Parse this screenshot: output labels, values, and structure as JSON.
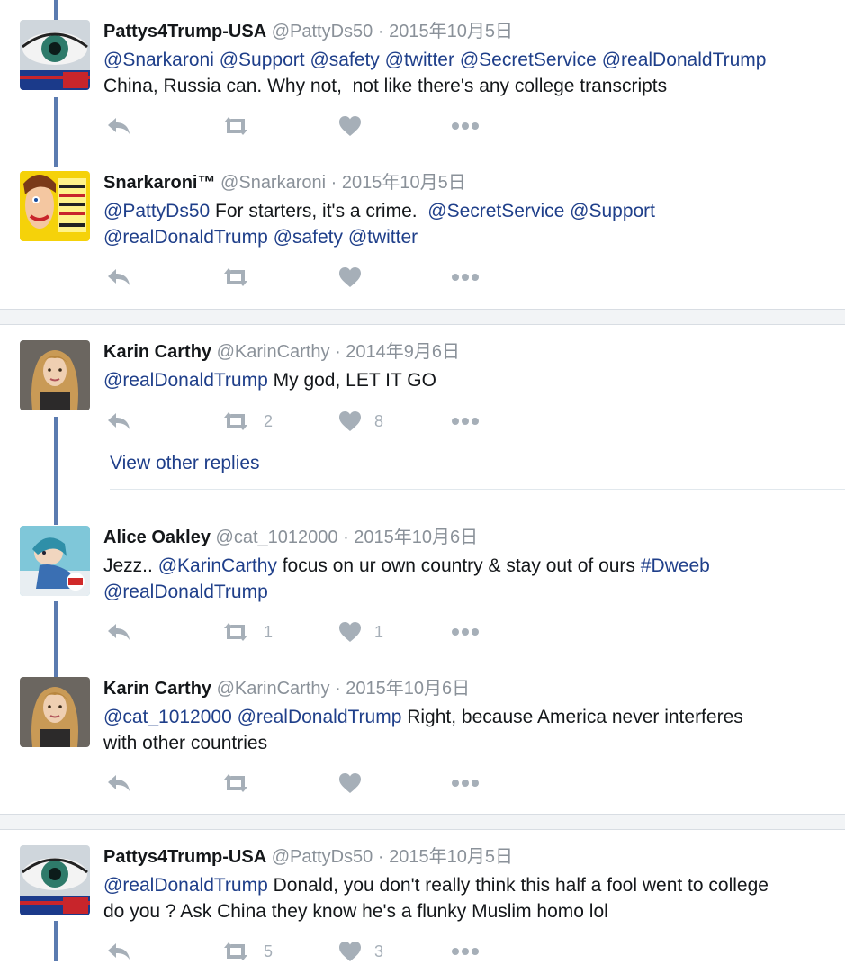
{
  "colors": {
    "link": "#1f3f8a",
    "muted": "#8a9199",
    "thread_line": "#5b7bb0",
    "action_icon": "#a6afb8"
  },
  "tweets": [
    {
      "name": "Pattys4Trump-USA",
      "handle": "@PattyDs50",
      "separator": "·",
      "date": "2015年10月5日",
      "avatar": "eye-flag-avatar",
      "line1": [
        {
          "t": "@Snarkaroni",
          "m": true
        },
        {
          "t": " ",
          "m": false
        },
        {
          "t": "@Support",
          "m": true
        },
        {
          "t": " ",
          "m": false
        },
        {
          "t": "@safety",
          "m": true
        },
        {
          "t": " ",
          "m": false
        },
        {
          "t": "@twitter",
          "m": true
        },
        {
          "t": " ",
          "m": false
        },
        {
          "t": "@SecretService",
          "m": true
        },
        {
          "t": " ",
          "m": false
        },
        {
          "t": "@realDonaldTrump",
          "m": true
        }
      ],
      "line2": [
        {
          "t": "China, Russia can. Why not,  not like there's any college transcripts",
          "m": false
        }
      ],
      "retweets": "",
      "likes": ""
    },
    {
      "name": "Snarkaroni™",
      "handle": "@Snarkaroni",
      "separator": "·",
      "date": "2015年10月5日",
      "avatar": "comic-book-avatar",
      "line1": [
        {
          "t": "@PattyDs50",
          "m": true
        },
        {
          "t": " For starters, it's a crime.  ",
          "m": false
        },
        {
          "t": "@SecretService",
          "m": true
        },
        {
          "t": " ",
          "m": false
        },
        {
          "t": "@Support",
          "m": true
        }
      ],
      "line2": [
        {
          "t": "@realDonaldTrump",
          "m": true
        },
        {
          "t": " ",
          "m": false
        },
        {
          "t": "@safety",
          "m": true
        },
        {
          "t": " ",
          "m": false
        },
        {
          "t": "@twitter",
          "m": true
        }
      ],
      "retweets": "",
      "likes": ""
    },
    {
      "name": "Karin Carthy",
      "handle": "@KarinCarthy",
      "separator": "·",
      "date": "2014年9月6日",
      "avatar": "woman-portrait-avatar",
      "line1": [
        {
          "t": "@realDonaldTrump",
          "m": true
        },
        {
          "t": " My god, LET IT GO",
          "m": false
        }
      ],
      "line2": [],
      "retweets": "2",
      "likes": "8"
    },
    {
      "name": "Alice Oakley",
      "handle": "@cat_1012000",
      "separator": "·",
      "date": "2015年10月6日",
      "avatar": "illustration-avatar",
      "line1": [
        {
          "t": "Jezz.. ",
          "m": false
        },
        {
          "t": "@KarinCarthy",
          "m": true
        },
        {
          "t": " focus on ur own country & stay out of ours ",
          "m": false
        },
        {
          "t": "#Dweeb",
          "m": true
        }
      ],
      "line2": [
        {
          "t": "@realDonaldTrump",
          "m": true
        }
      ],
      "retweets": "1",
      "likes": "1"
    },
    {
      "name": "Karin Carthy",
      "handle": "@KarinCarthy",
      "separator": "·",
      "date": "2015年10月6日",
      "avatar": "woman-portrait-avatar",
      "line1": [
        {
          "t": "@cat_1012000",
          "m": true
        },
        {
          "t": " ",
          "m": false
        },
        {
          "t": "@realDonaldTrump",
          "m": true
        },
        {
          "t": " Right, because America never interferes",
          "m": false
        }
      ],
      "line2": [
        {
          "t": "with other countries",
          "m": false
        }
      ],
      "retweets": "",
      "likes": ""
    },
    {
      "name": "Pattys4Trump-USA",
      "handle": "@PattyDs50",
      "separator": "·",
      "date": "2015年10月5日",
      "avatar": "eye-flag-avatar",
      "line1": [
        {
          "t": "@realDonaldTrump",
          "m": true
        },
        {
          "t": " Donald, you don't really think this half a fool went to college",
          "m": false
        }
      ],
      "line2": [
        {
          "t": "do you ? Ask China they know he's a flunky Muslim homo lol",
          "m": false
        }
      ],
      "retweets": "5",
      "likes": "3"
    }
  ],
  "view_other_replies": "View other replies",
  "action_icons": [
    "reply-icon",
    "retweet-icon",
    "like-icon",
    "more-icon"
  ]
}
